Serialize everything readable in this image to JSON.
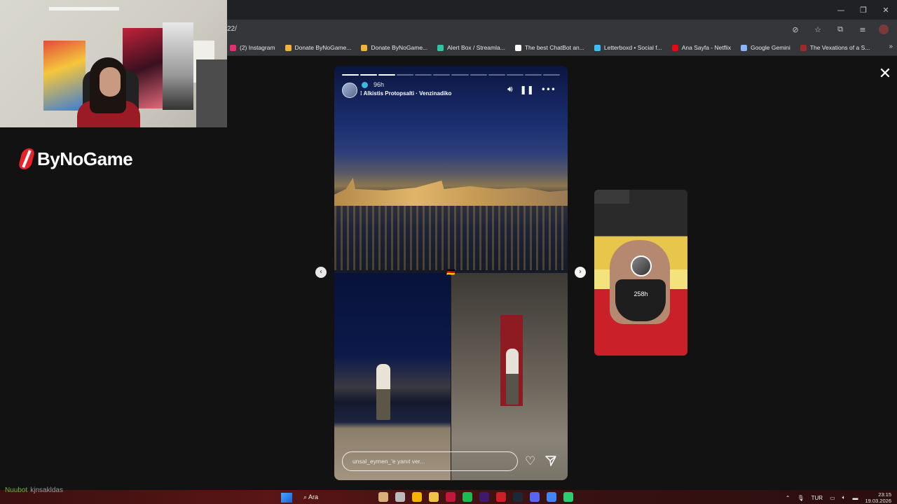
{
  "browser": {
    "url_fragment": "22/",
    "bookmarks": [
      {
        "label": "(2) Instagram",
        "color": "#e1306c"
      },
      {
        "label": "Donate ByNoGame...",
        "color": "#f0b43c"
      },
      {
        "label": "Donate ByNoGame...",
        "color": "#f0b43c"
      },
      {
        "label": "Alert Box / Streamla...",
        "color": "#31c3a2"
      },
      {
        "label": "The best ChatBot an...",
        "color": "#ffffff"
      },
      {
        "label": "Letterboxd • Social f...",
        "color": "#40bcf4"
      },
      {
        "label": "Ana Sayfa - Netflix",
        "color": "#e50914"
      },
      {
        "label": "Google Gemini",
        "color": "#8ab4f8"
      },
      {
        "label": "The Vexations of a S...",
        "color": "#9b2a2a"
      }
    ],
    "more_icon": "»"
  },
  "overlay": {
    "logo_text": "ByNoGame",
    "chat_user": "Nuubot",
    "chat_message": "kjnsakldas"
  },
  "story": {
    "progress_total": 12,
    "progress_done": 3,
    "time_ago": "96h",
    "music": "Alkistis Protopsalti · Venzinadiko",
    "reply_placeholder": "unsal_eymen_'e yanıt ver...",
    "flag_emoji": "🇩🇪",
    "close_icon": "✕"
  },
  "next_story": {
    "username": "",
    "time_ago": "258h"
  },
  "taskbar": {
    "search_label": "Ara",
    "language": "TUR",
    "time": "23:15",
    "date": "19.03.2026"
  }
}
